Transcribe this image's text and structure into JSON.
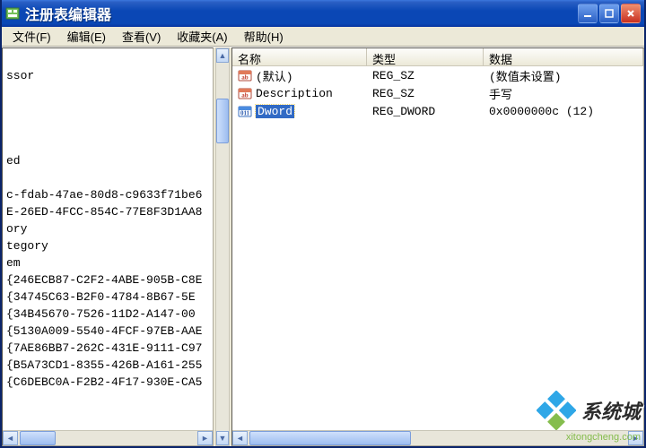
{
  "window": {
    "title": "注册表编辑器"
  },
  "menu": {
    "file": "文件(F)",
    "edit": "编辑(E)",
    "view": "查看(V)",
    "fav": "收藏夹(A)",
    "help": "帮助(H)"
  },
  "tree_lines": [
    "",
    "ssor",
    "",
    "",
    "",
    "",
    "ed",
    "",
    "c-fdab-47ae-80d8-c9633f71be6",
    "E-26ED-4FCC-854C-77E8F3D1AA8",
    "ory",
    "tegory",
    "em",
    "{246ECB87-C2F2-4ABE-905B-C8E",
    "{34745C63-B2F0-4784-8B67-5E",
    "{34B45670-7526-11D2-A147-00",
    "{5130A009-5540-4FCF-97EB-AAE",
    "{7AE86BB7-262C-431E-9111-C97",
    "{B5A73CD1-8355-426B-A161-255",
    "{C6DEBC0A-F2B2-4F17-930E-CA5"
  ],
  "columns": {
    "name": "名称",
    "type": "类型",
    "data": "数据"
  },
  "values": [
    {
      "icon": "sz",
      "name": "(默认)",
      "type": "REG_SZ",
      "data": "(数值未设置)",
      "selected": false
    },
    {
      "icon": "sz",
      "name": "Description",
      "type": "REG_SZ",
      "data": "手写",
      "selected": false
    },
    {
      "icon": "dword",
      "name": "Dword",
      "type": "REG_DWORD",
      "data": "0x0000000c (12)",
      "selected": true
    }
  ],
  "watermark": {
    "text": "系统城",
    "url": "xitongcheng.com"
  }
}
